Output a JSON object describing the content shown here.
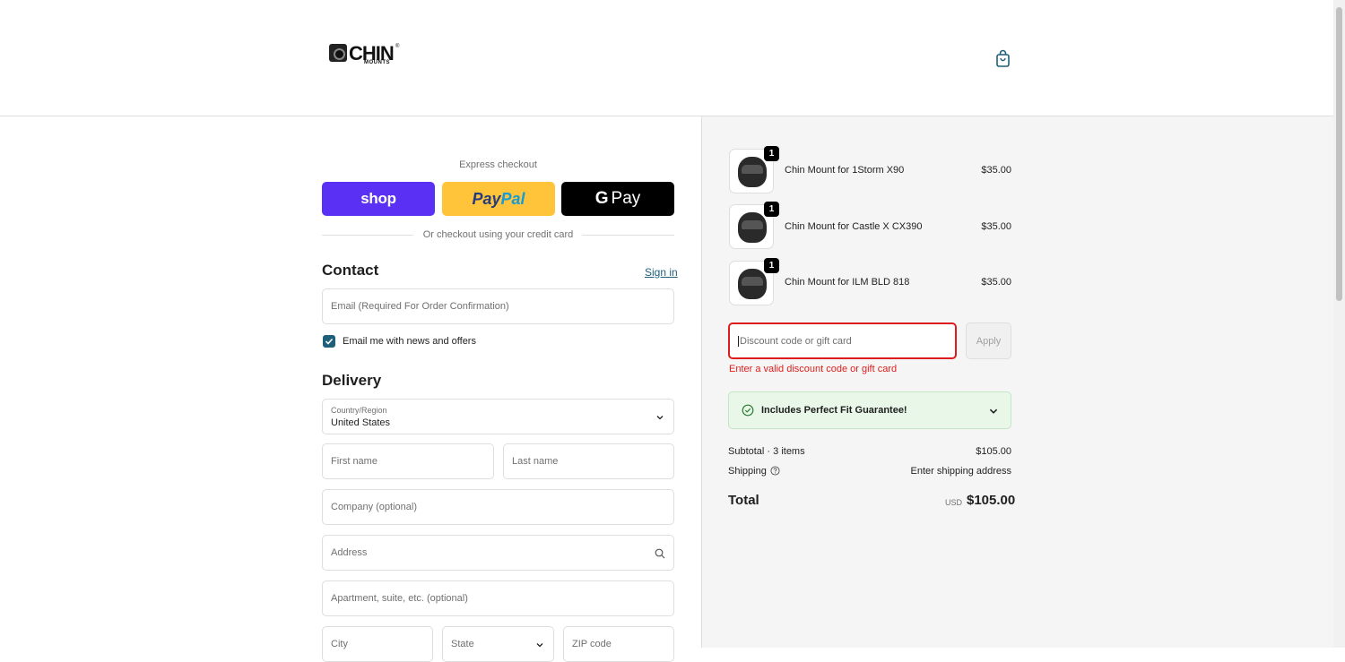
{
  "header": {
    "logo": {
      "main": "CHIN",
      "sub": "MOUNTS",
      "reg": "®"
    },
    "cart_icon": "shopping-bag-icon"
  },
  "express": {
    "label": "Express checkout",
    "shop_label": "shop",
    "paypal_label_a": "Pay",
    "paypal_label_b": "Pal",
    "gpay_g": "G",
    "gpay_label": "Pay",
    "divider_text": "Or checkout using your credit card"
  },
  "contact": {
    "title": "Contact",
    "sign_in": "Sign in",
    "email_placeholder": "Email (Required For Order Confirmation)",
    "newsletter_label": "Email me with news and offers",
    "newsletter_checked": true
  },
  "delivery": {
    "title": "Delivery",
    "country_label": "Country/Region",
    "country_value": "United States",
    "first_name_placeholder": "First name",
    "last_name_placeholder": "Last name",
    "company_placeholder": "Company (optional)",
    "address_placeholder": "Address",
    "apartment_placeholder": "Apartment, suite, etc. (optional)",
    "city_placeholder": "City",
    "state_placeholder": "State",
    "zip_placeholder": "ZIP code"
  },
  "order": {
    "items": [
      {
        "name": "Chin Mount for 1Storm X90",
        "price": "$35.00",
        "qty": "1"
      },
      {
        "name": "Chin Mount for Castle X CX390",
        "price": "$35.00",
        "qty": "1"
      },
      {
        "name": "Chin Mount for ILM BLD 818",
        "price": "$35.00",
        "qty": "1"
      }
    ],
    "discount_placeholder": "Discount code or gift card",
    "apply_label": "Apply",
    "discount_error": "Enter a valid discount code or gift card",
    "guarantee_label": "Includes Perfect Fit Guarantee!",
    "subtotal_label": "Subtotal · 3 items",
    "subtotal_value": "$105.00",
    "shipping_label": "Shipping",
    "shipping_value": "Enter shipping address",
    "total_label": "Total",
    "total_currency": "USD",
    "total_value": "$105.00"
  },
  "colors": {
    "shop": "#5a31f4",
    "paypal": "#ffc439",
    "gpay": "#000000",
    "accent": "#1f5f7a",
    "error": "#dd1d1d",
    "guarantee_bg": "#e8f7e8"
  }
}
